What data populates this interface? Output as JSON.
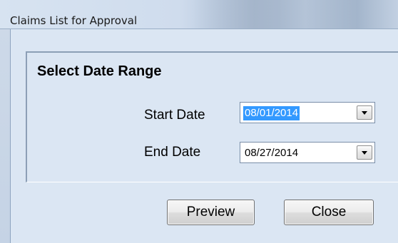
{
  "window": {
    "title": "Claims List for Approval"
  },
  "group": {
    "title": "Select Date Range"
  },
  "start_date": {
    "label": "Start Date",
    "value": "08/01/2014"
  },
  "end_date": {
    "label": "End Date",
    "value": "08/27/2014"
  },
  "buttons": {
    "preview": "Preview",
    "close": "Close"
  },
  "icons": {
    "dropdown": "chevron-down-icon"
  },
  "colors": {
    "client_bg": "#dbe6f3",
    "selection": "#3399ff"
  }
}
